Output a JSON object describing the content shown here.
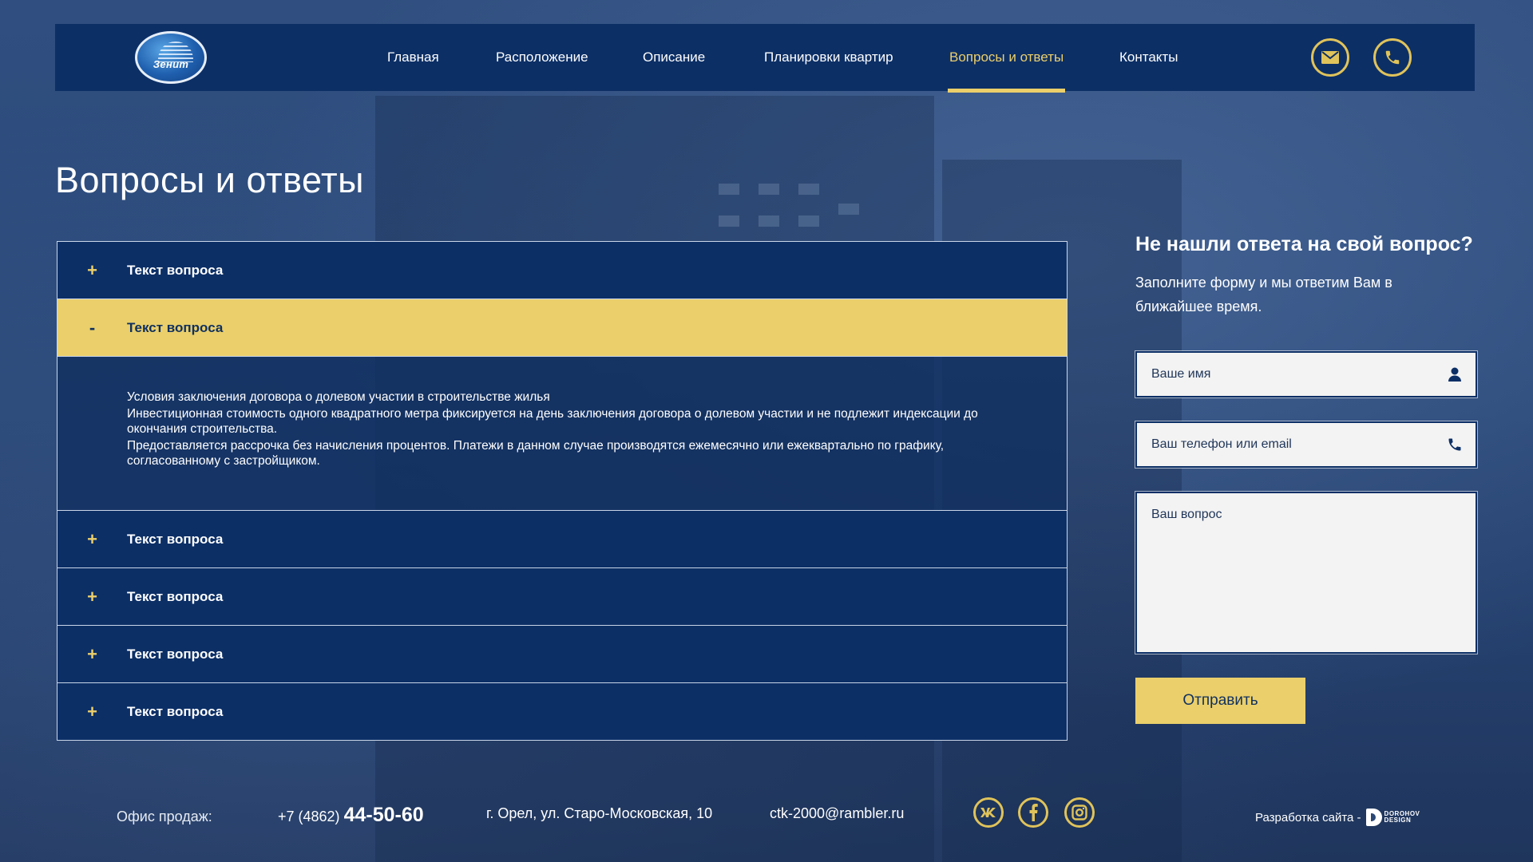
{
  "header": {
    "logo_text": "Зенит",
    "nav": [
      {
        "label": "Главная",
        "active": false
      },
      {
        "label": "Расположение",
        "active": false
      },
      {
        "label": "Описание",
        "active": false
      },
      {
        "label": "Планировки квартир",
        "active": false
      },
      {
        "label": "Вопросы и ответы",
        "active": true
      },
      {
        "label": "Контакты",
        "active": false
      }
    ],
    "icons": [
      "mail-icon",
      "phone-icon"
    ]
  },
  "page": {
    "title": "Вопросы и ответы"
  },
  "faq": {
    "items": [
      {
        "toggle": "+",
        "question": "Текст вопроса",
        "open": false
      },
      {
        "toggle": "-",
        "question": "Текст вопроса",
        "open": true,
        "answer": [
          "Условия заключения договора о долевом участии в строительстве жилья",
          "Инвестиционная стоимость одного квадратного метра фиксируется на день заключения договора о долевом участии и не подлежит индексации до окончания строительства.",
          "Предоставляется рассрочка без начисления процентов. Платежи в данном случае производятся ежемесячно или ежеквартально по графику, согласованному с застройщиком."
        ]
      },
      {
        "toggle": "+",
        "question": "Текст вопроса",
        "open": false
      },
      {
        "toggle": "+",
        "question": "Текст вопроса",
        "open": false
      },
      {
        "toggle": "+",
        "question": "Текст вопроса",
        "open": false
      },
      {
        "toggle": "+",
        "question": "Текст вопроса",
        "open": false
      }
    ]
  },
  "form": {
    "title": "Не нашли ответа на свой вопрос?",
    "subtitle": "Заполните форму и мы ответим Вам в ближайшее время.",
    "name_placeholder": "Ваше имя",
    "contact_placeholder": "Ваш телефон или email",
    "question_placeholder": "Ваш вопрос",
    "submit_label": "Отправить"
  },
  "footer": {
    "office_label": "Офис продаж:",
    "phone_prefix": "+7 (4862)",
    "phone_number": "44-50-60",
    "address": "г. Орел, ул. Старо-Московская, 10",
    "email": "ctk-2000@rambler.ru",
    "social": [
      "vk-icon",
      "facebook-icon",
      "instagram-icon"
    ],
    "dev_label": "Разработка сайта -",
    "dev_logo_line1": "DOROHOV",
    "dev_logo_line2": "DESIGN"
  },
  "colors": {
    "navy": "#0c2f66",
    "accent": "#eacf6b",
    "background": "#2a4775"
  }
}
